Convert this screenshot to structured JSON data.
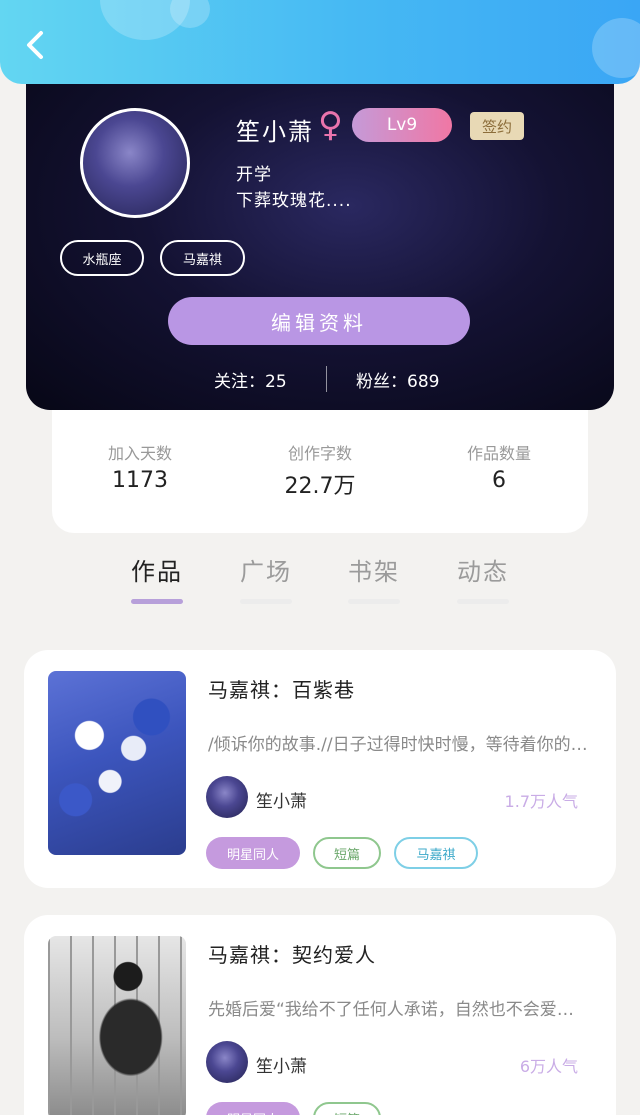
{
  "colors": {
    "accent": "#b996e4",
    "topbar": "#46b9f3",
    "gender": "#ea74ad"
  },
  "nav": {
    "back_icon": "chevron-left-icon"
  },
  "profile": {
    "name": "笙小萧",
    "gender_icon": "♀",
    "level": "Lv9",
    "contract_badge": "签约",
    "bio_line1": "开学",
    "bio_line2": "下葬玫瑰花....",
    "tags": [
      "水瓶座",
      "马嘉祺"
    ],
    "edit_button": "编辑资料",
    "following": "关注：25",
    "followers": "粉丝：689"
  },
  "stats": [
    {
      "label": "加入天数",
      "value": "1173"
    },
    {
      "label": "创作字数",
      "value": "22.7万"
    },
    {
      "label": "作品数量",
      "value": "6"
    }
  ],
  "tabs": [
    {
      "label": "作品",
      "active": true
    },
    {
      "label": "广场",
      "active": false
    },
    {
      "label": "书架",
      "active": false
    },
    {
      "label": "动态",
      "active": false
    }
  ],
  "works": [
    {
      "title": "马嘉祺：百紫巷",
      "description": "/倾诉你的故事.//日子过得时快时慢，等待着你的到来",
      "author": "笙小萧",
      "popularity": "1.7万人气",
      "tags": [
        "明星同人",
        "短篇",
        "马嘉祺"
      ]
    },
    {
      "title": "马嘉祺：契约爱人",
      "description": "先婚后爱“我给不了任何人承诺，自然也不会爱上你”",
      "author": "笙小萧",
      "popularity": "6万人气",
      "tags": [
        "明星同人",
        "短篇"
      ]
    }
  ]
}
